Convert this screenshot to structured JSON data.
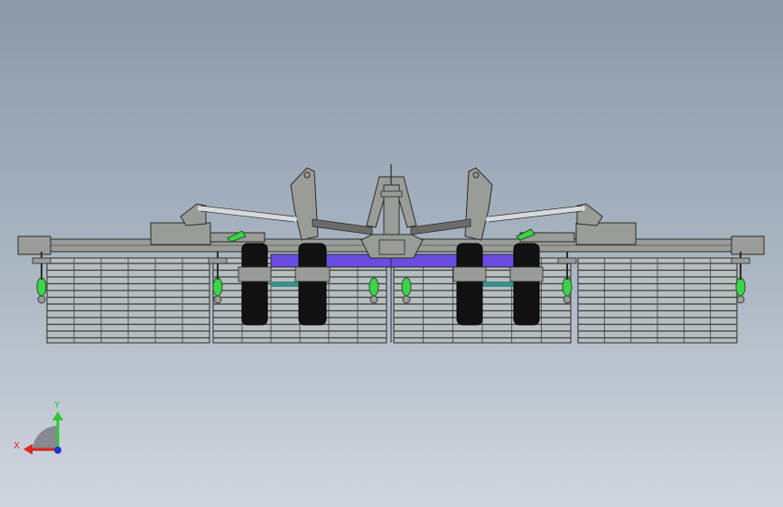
{
  "viewport": {
    "background_top": "#8c99a9",
    "background_bottom": "#d0d6de"
  },
  "model": {
    "frame_color": "#9a9c98",
    "edge_color": "#2a2b2a",
    "tube_color": "#6a6c69",
    "axle_color": "#6b4ce0",
    "cylinder_color": "#d6dadd",
    "accent_color": "#3fd24a",
    "tire_color": "#121212",
    "teal_color": "#3e8e8c"
  },
  "triad": {
    "x_label": "X",
    "y_label": "Y",
    "x_color": "#e0261f",
    "y_color": "#2ec63a",
    "z_color": "#2034d6"
  }
}
